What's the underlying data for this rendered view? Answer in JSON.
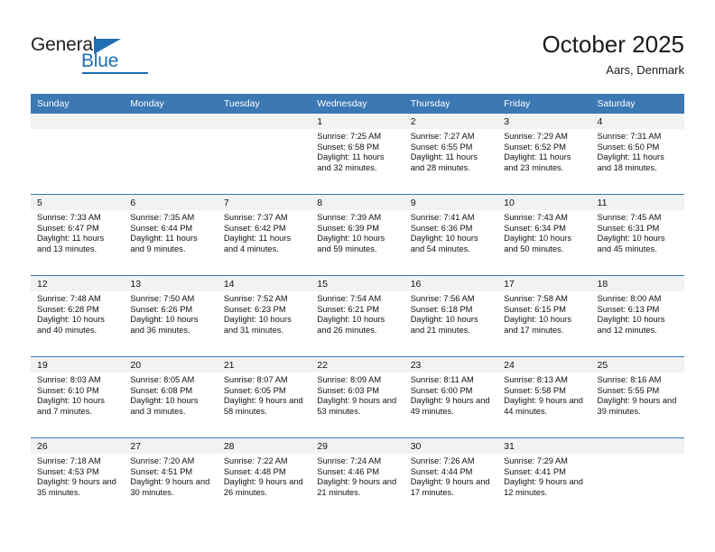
{
  "brand": {
    "name_part1": "General",
    "name_part2": "Blue",
    "triangle_color": "#1f6fb5"
  },
  "header": {
    "month_title": "October 2025",
    "location": "Aars, Denmark"
  },
  "theme": {
    "header_blue": "#3b78b4",
    "daynum_band": "#f2f2f2",
    "text": "#111111"
  },
  "weekdays": [
    "Sunday",
    "Monday",
    "Tuesday",
    "Wednesday",
    "Thursday",
    "Friday",
    "Saturday"
  ],
  "weeks": [
    [
      {
        "day": "",
        "sunrise": "",
        "sunset": "",
        "daylight": "",
        "empty": true
      },
      {
        "day": "",
        "sunrise": "",
        "sunset": "",
        "daylight": "",
        "empty": true
      },
      {
        "day": "",
        "sunrise": "",
        "sunset": "",
        "daylight": "",
        "empty": true
      },
      {
        "day": "1",
        "sunrise": "Sunrise: 7:25 AM",
        "sunset": "Sunset: 6:58 PM",
        "daylight": "Daylight: 11 hours and 32 minutes."
      },
      {
        "day": "2",
        "sunrise": "Sunrise: 7:27 AM",
        "sunset": "Sunset: 6:55 PM",
        "daylight": "Daylight: 11 hours and 28 minutes."
      },
      {
        "day": "3",
        "sunrise": "Sunrise: 7:29 AM",
        "sunset": "Sunset: 6:52 PM",
        "daylight": "Daylight: 11 hours and 23 minutes."
      },
      {
        "day": "4",
        "sunrise": "Sunrise: 7:31 AM",
        "sunset": "Sunset: 6:50 PM",
        "daylight": "Daylight: 11 hours and 18 minutes."
      }
    ],
    [
      {
        "day": "5",
        "sunrise": "Sunrise: 7:33 AM",
        "sunset": "Sunset: 6:47 PM",
        "daylight": "Daylight: 11 hours and 13 minutes."
      },
      {
        "day": "6",
        "sunrise": "Sunrise: 7:35 AM",
        "sunset": "Sunset: 6:44 PM",
        "daylight": "Daylight: 11 hours and 9 minutes."
      },
      {
        "day": "7",
        "sunrise": "Sunrise: 7:37 AM",
        "sunset": "Sunset: 6:42 PM",
        "daylight": "Daylight: 11 hours and 4 minutes."
      },
      {
        "day": "8",
        "sunrise": "Sunrise: 7:39 AM",
        "sunset": "Sunset: 6:39 PM",
        "daylight": "Daylight: 10 hours and 59 minutes."
      },
      {
        "day": "9",
        "sunrise": "Sunrise: 7:41 AM",
        "sunset": "Sunset: 6:36 PM",
        "daylight": "Daylight: 10 hours and 54 minutes."
      },
      {
        "day": "10",
        "sunrise": "Sunrise: 7:43 AM",
        "sunset": "Sunset: 6:34 PM",
        "daylight": "Daylight: 10 hours and 50 minutes."
      },
      {
        "day": "11",
        "sunrise": "Sunrise: 7:45 AM",
        "sunset": "Sunset: 6:31 PM",
        "daylight": "Daylight: 10 hours and 45 minutes."
      }
    ],
    [
      {
        "day": "12",
        "sunrise": "Sunrise: 7:48 AM",
        "sunset": "Sunset: 6:28 PM",
        "daylight": "Daylight: 10 hours and 40 minutes."
      },
      {
        "day": "13",
        "sunrise": "Sunrise: 7:50 AM",
        "sunset": "Sunset: 6:26 PM",
        "daylight": "Daylight: 10 hours and 36 minutes."
      },
      {
        "day": "14",
        "sunrise": "Sunrise: 7:52 AM",
        "sunset": "Sunset: 6:23 PM",
        "daylight": "Daylight: 10 hours and 31 minutes."
      },
      {
        "day": "15",
        "sunrise": "Sunrise: 7:54 AM",
        "sunset": "Sunset: 6:21 PM",
        "daylight": "Daylight: 10 hours and 26 minutes."
      },
      {
        "day": "16",
        "sunrise": "Sunrise: 7:56 AM",
        "sunset": "Sunset: 6:18 PM",
        "daylight": "Daylight: 10 hours and 21 minutes."
      },
      {
        "day": "17",
        "sunrise": "Sunrise: 7:58 AM",
        "sunset": "Sunset: 6:15 PM",
        "daylight": "Daylight: 10 hours and 17 minutes."
      },
      {
        "day": "18",
        "sunrise": "Sunrise: 8:00 AM",
        "sunset": "Sunset: 6:13 PM",
        "daylight": "Daylight: 10 hours and 12 minutes."
      }
    ],
    [
      {
        "day": "19",
        "sunrise": "Sunrise: 8:03 AM",
        "sunset": "Sunset: 6:10 PM",
        "daylight": "Daylight: 10 hours and 7 minutes."
      },
      {
        "day": "20",
        "sunrise": "Sunrise: 8:05 AM",
        "sunset": "Sunset: 6:08 PM",
        "daylight": "Daylight: 10 hours and 3 minutes."
      },
      {
        "day": "21",
        "sunrise": "Sunrise: 8:07 AM",
        "sunset": "Sunset: 6:05 PM",
        "daylight": "Daylight: 9 hours and 58 minutes."
      },
      {
        "day": "22",
        "sunrise": "Sunrise: 8:09 AM",
        "sunset": "Sunset: 6:03 PM",
        "daylight": "Daylight: 9 hours and 53 minutes."
      },
      {
        "day": "23",
        "sunrise": "Sunrise: 8:11 AM",
        "sunset": "Sunset: 6:00 PM",
        "daylight": "Daylight: 9 hours and 49 minutes."
      },
      {
        "day": "24",
        "sunrise": "Sunrise: 8:13 AM",
        "sunset": "Sunset: 5:58 PM",
        "daylight": "Daylight: 9 hours and 44 minutes."
      },
      {
        "day": "25",
        "sunrise": "Sunrise: 8:16 AM",
        "sunset": "Sunset: 5:55 PM",
        "daylight": "Daylight: 9 hours and 39 minutes."
      }
    ],
    [
      {
        "day": "26",
        "sunrise": "Sunrise: 7:18 AM",
        "sunset": "Sunset: 4:53 PM",
        "daylight": "Daylight: 9 hours and 35 minutes."
      },
      {
        "day": "27",
        "sunrise": "Sunrise: 7:20 AM",
        "sunset": "Sunset: 4:51 PM",
        "daylight": "Daylight: 9 hours and 30 minutes."
      },
      {
        "day": "28",
        "sunrise": "Sunrise: 7:22 AM",
        "sunset": "Sunset: 4:48 PM",
        "daylight": "Daylight: 9 hours and 26 minutes."
      },
      {
        "day": "29",
        "sunrise": "Sunrise: 7:24 AM",
        "sunset": "Sunset: 4:46 PM",
        "daylight": "Daylight: 9 hours and 21 minutes."
      },
      {
        "day": "30",
        "sunrise": "Sunrise: 7:26 AM",
        "sunset": "Sunset: 4:44 PM",
        "daylight": "Daylight: 9 hours and 17 minutes."
      },
      {
        "day": "31",
        "sunrise": "Sunrise: 7:29 AM",
        "sunset": "Sunset: 4:41 PM",
        "daylight": "Daylight: 9 hours and 12 minutes."
      },
      {
        "day": "",
        "sunrise": "",
        "sunset": "",
        "daylight": "",
        "empty": true
      }
    ]
  ]
}
